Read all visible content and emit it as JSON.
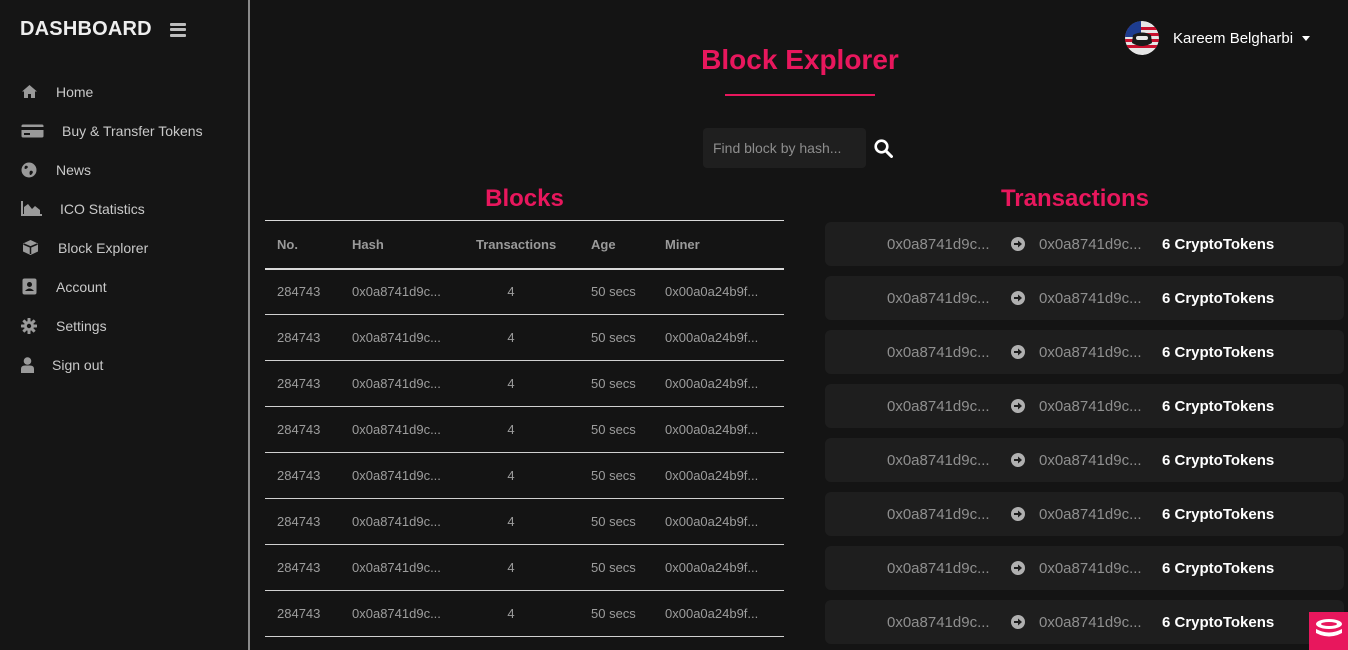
{
  "sidebar": {
    "brand": "DASHBOARD",
    "items": [
      {
        "label": "Home",
        "icon": "home-icon"
      },
      {
        "label": "Buy & Transfer Tokens",
        "icon": "credit-card-icon"
      },
      {
        "label": "News",
        "icon": "globe-icon"
      },
      {
        "label": "ICO Statistics",
        "icon": "area-chart-icon"
      },
      {
        "label": "Block Explorer",
        "icon": "cube-icon"
      },
      {
        "label": "Account",
        "icon": "address-book-icon"
      },
      {
        "label": "Settings",
        "icon": "gear-icon"
      },
      {
        "label": "Sign out",
        "icon": "user-icon"
      }
    ]
  },
  "header": {
    "user_name": "Kareem Belgharbi"
  },
  "page": {
    "title": "Block Explorer"
  },
  "search": {
    "placeholder": "Find block by hash..."
  },
  "blocks": {
    "title": "Blocks",
    "columns": [
      "No.",
      "Hash",
      "Transactions",
      "Age",
      "Miner"
    ],
    "rows": [
      [
        "284743",
        "0x0a8741d9c...",
        "4",
        "50 secs",
        "0x00a0a24b9f..."
      ],
      [
        "284743",
        "0x0a8741d9c...",
        "4",
        "50 secs",
        "0x00a0a24b9f..."
      ],
      [
        "284743",
        "0x0a8741d9c...",
        "4",
        "50 secs",
        "0x00a0a24b9f..."
      ],
      [
        "284743",
        "0x0a8741d9c...",
        "4",
        "50 secs",
        "0x00a0a24b9f..."
      ],
      [
        "284743",
        "0x0a8741d9c...",
        "4",
        "50 secs",
        "0x00a0a24b9f..."
      ],
      [
        "284743",
        "0x0a8741d9c...",
        "4",
        "50 secs",
        "0x00a0a24b9f..."
      ],
      [
        "284743",
        "0x0a8741d9c...",
        "4",
        "50 secs",
        "0x00a0a24b9f..."
      ],
      [
        "284743",
        "0x0a8741d9c...",
        "4",
        "50 secs",
        "0x00a0a24b9f..."
      ]
    ]
  },
  "transactions": {
    "title": "Transactions",
    "items": [
      {
        "from": "0x0a8741d9c...",
        "to": "0x0a8741d9c...",
        "amount": "6 CryptoTokens"
      },
      {
        "from": "0x0a8741d9c...",
        "to": "0x0a8741d9c...",
        "amount": "6 CryptoTokens"
      },
      {
        "from": "0x0a8741d9c...",
        "to": "0x0a8741d9c...",
        "amount": "6 CryptoTokens"
      },
      {
        "from": "0x0a8741d9c...",
        "to": "0x0a8741d9c...",
        "amount": "6 CryptoTokens"
      },
      {
        "from": "0x0a8741d9c...",
        "to": "0x0a8741d9c...",
        "amount": "6 CryptoTokens"
      },
      {
        "from": "0x0a8741d9c...",
        "to": "0x0a8741d9c...",
        "amount": "6 CryptoTokens"
      },
      {
        "from": "0x0a8741d9c...",
        "to": "0x0a8741d9c...",
        "amount": "6 CryptoTokens"
      },
      {
        "from": "0x0a8741d9c...",
        "to": "0x0a8741d9c...",
        "amount": "6 CryptoTokens"
      }
    ]
  },
  "colors": {
    "accent": "#e8175d",
    "background": "#141414",
    "card": "#1e1e1e"
  }
}
